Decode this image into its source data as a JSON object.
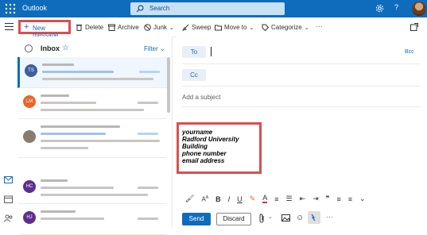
{
  "header": {
    "app_name": "Outlook",
    "search_placeholder": "Search",
    "colors": {
      "brand": "#0f6cbd",
      "search_bg": "#c7e0f4"
    }
  },
  "toolbar": {
    "new_message": "New message",
    "delete": "Delete",
    "archive": "Archive",
    "junk": "Junk",
    "sweep": "Sweep",
    "move_to": "Move to",
    "categorize": "Categorize",
    "more": "···"
  },
  "list": {
    "folder": "Inbox",
    "filter": "Filter",
    "avatars": [
      "TS",
      "LM",
      "",
      "HC",
      "HJ"
    ]
  },
  "compose": {
    "to_label": "To",
    "cc_label": "Cc",
    "bcc_label": "Bcc",
    "subject_placeholder": "Add a subject",
    "signature": [
      "yourname",
      "Radford University",
      "Building",
      "phone number",
      "email address"
    ],
    "send": "Send",
    "discard": "Discard"
  },
  "annotation_color": "#d94f4f"
}
